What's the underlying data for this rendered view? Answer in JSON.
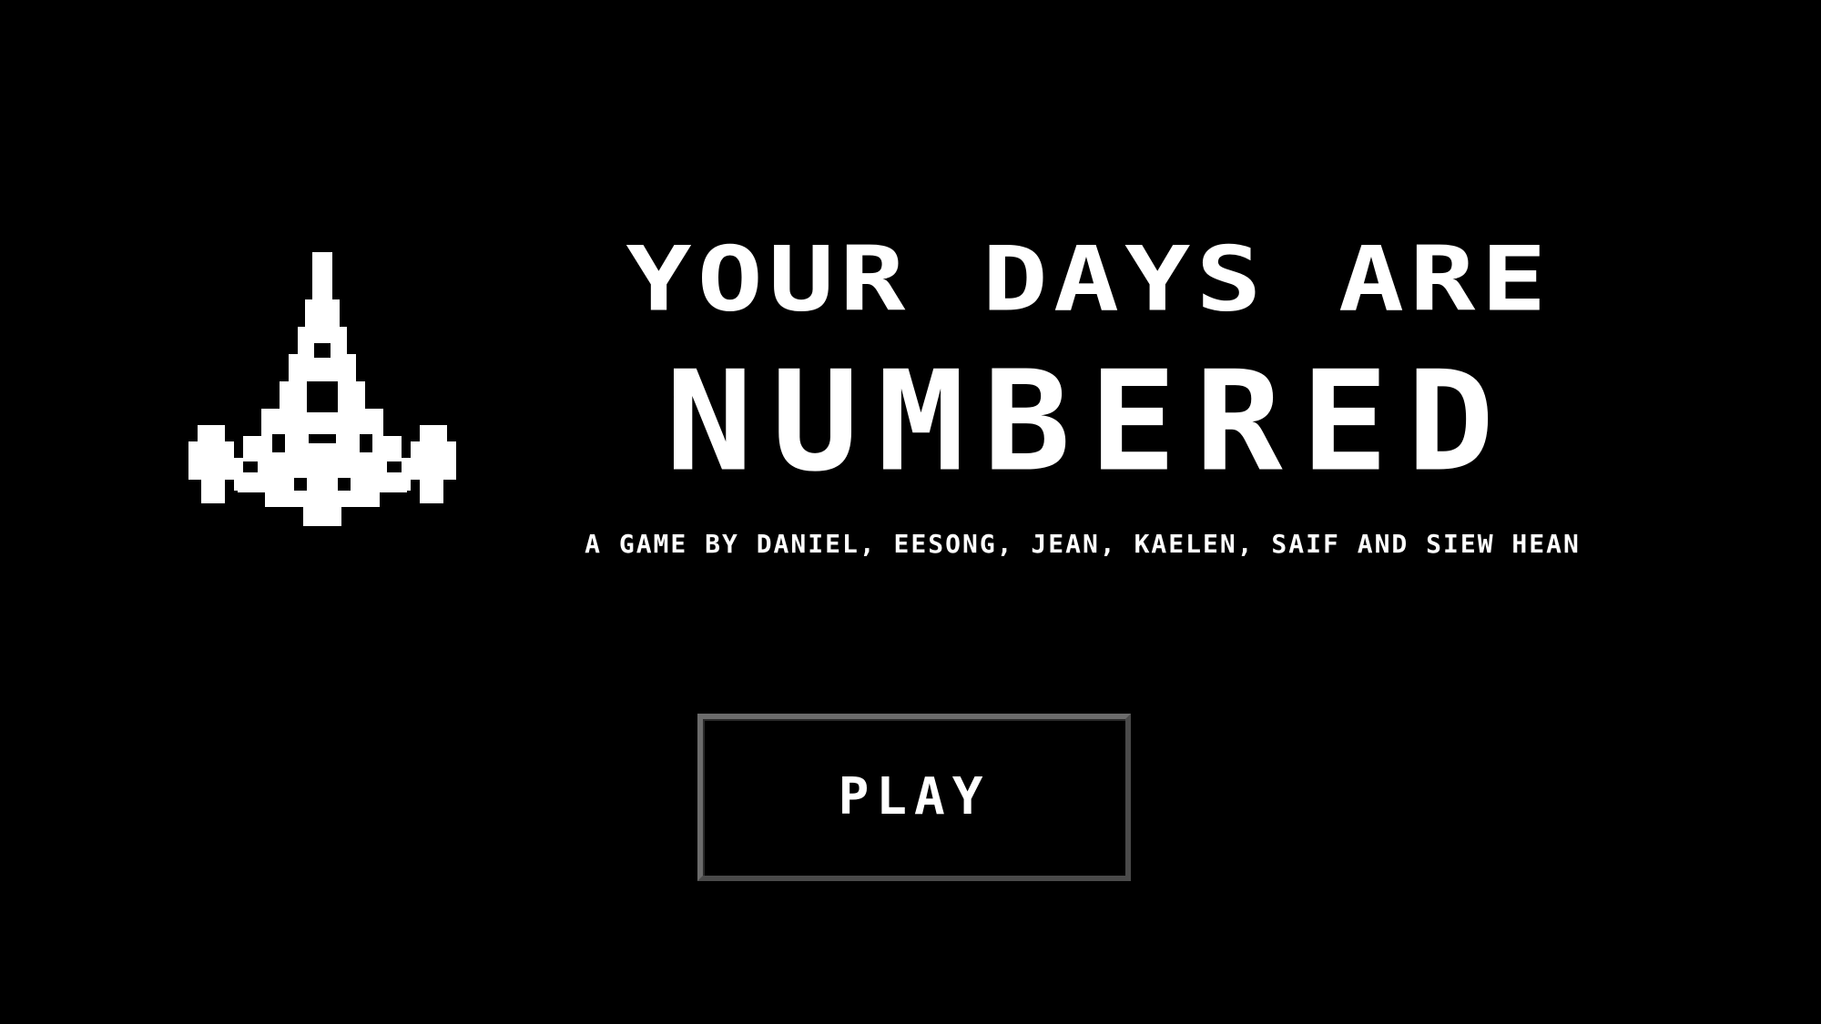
{
  "screen": "title",
  "logo": {
    "icon": "spaceship-icon",
    "color": "#ffffff"
  },
  "title": {
    "line1": "YOUR DAYS ARE",
    "line2": "NUMBERED"
  },
  "subtitle": "A GAME BY DANIEL, EESONG, JEAN, KAELEN, SAIF AND SIEW HEAN",
  "play_button": {
    "label": "PLAY"
  },
  "colors": {
    "background": "#000000",
    "text": "#ffffff",
    "button_border": "#5a5a5a"
  }
}
